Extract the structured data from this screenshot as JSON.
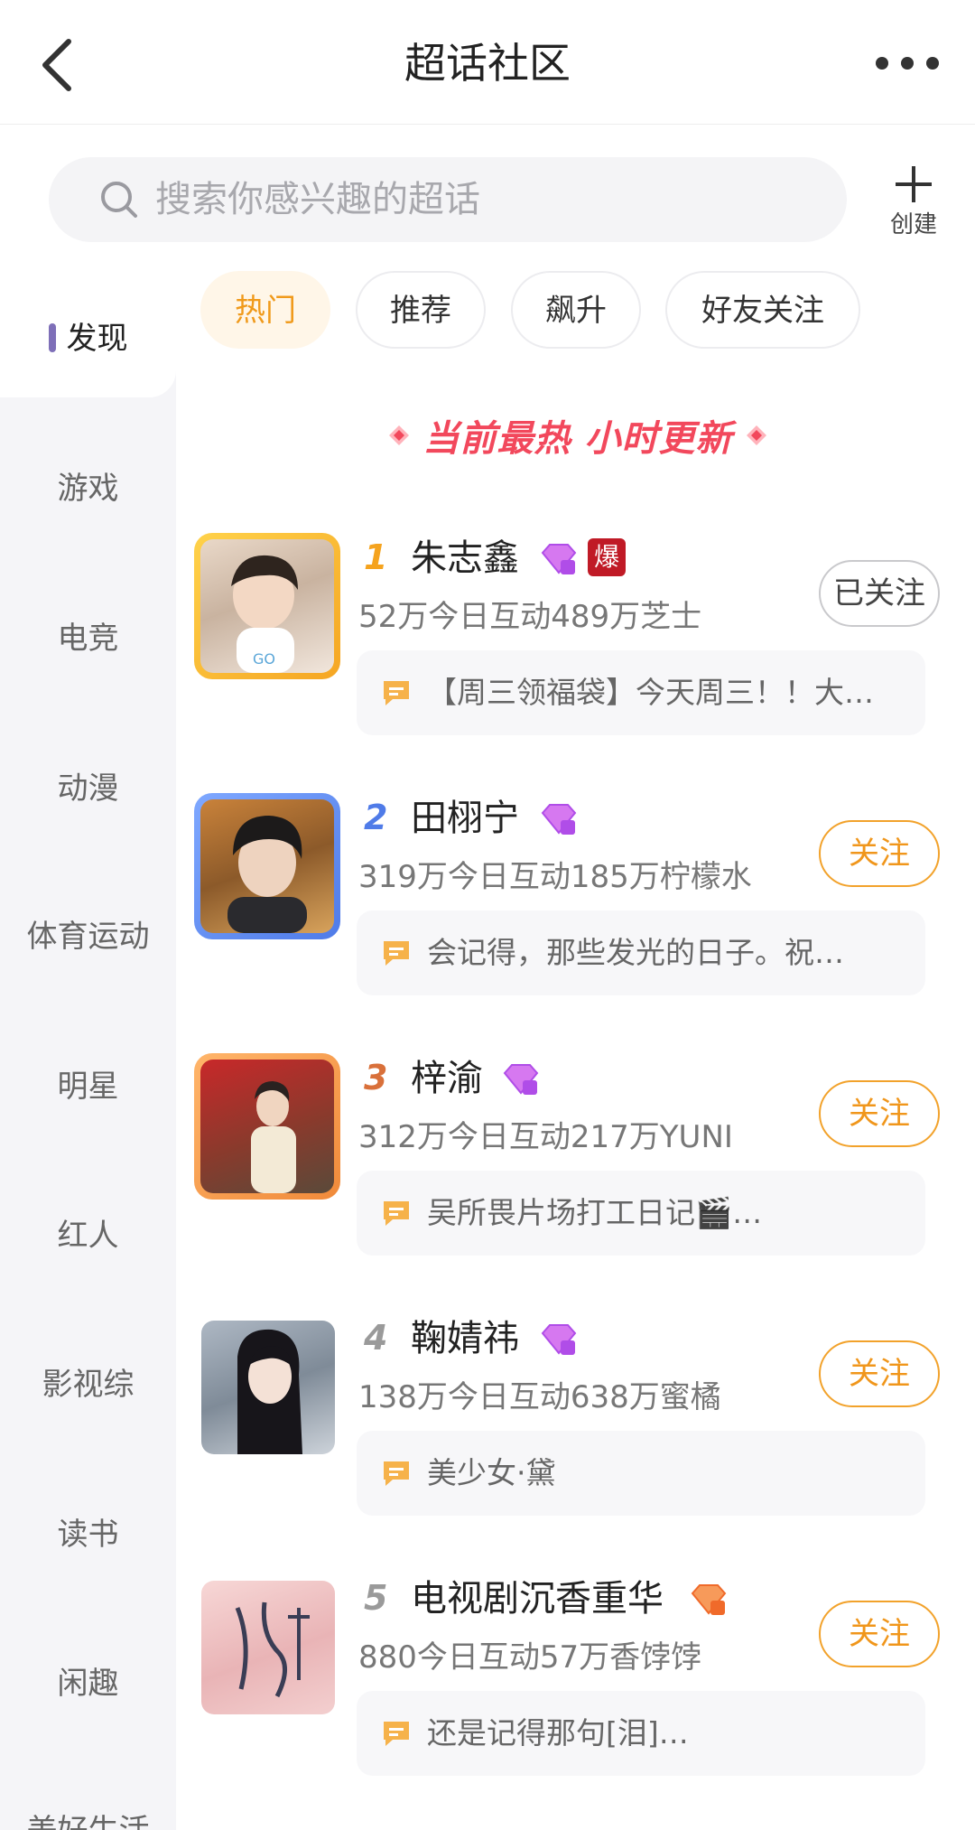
{
  "header": {
    "title": "超话社区"
  },
  "search": {
    "placeholder": "搜索你感兴趣的超话"
  },
  "create": {
    "label": "创建"
  },
  "sidebar": {
    "items": [
      {
        "label": "发现",
        "active": true
      },
      {
        "label": "游戏"
      },
      {
        "label": "电竞"
      },
      {
        "label": "动漫"
      },
      {
        "label": "体育运动"
      },
      {
        "label": "明星"
      },
      {
        "label": "红人"
      },
      {
        "label": "影视综"
      },
      {
        "label": "读书"
      },
      {
        "label": "闲趣"
      },
      {
        "label": "美好生活"
      }
    ]
  },
  "tabs": [
    {
      "label": "热门",
      "active": true
    },
    {
      "label": "推荐"
    },
    {
      "label": "飙升"
    },
    {
      "label": "好友关注"
    }
  ],
  "banner": {
    "text": "当前最热 小时更新"
  },
  "topics": [
    {
      "rank": "1",
      "name": "朱志鑫",
      "hot_badge": "爆",
      "stats": "52万今日互动489万芝士",
      "post": "【周三领福袋】今天周三！！大…",
      "follow_label": "已关注",
      "followed": true
    },
    {
      "rank": "2",
      "name": "田栩宁",
      "stats": "319万今日互动185万柠檬水",
      "post": "会记得，那些发光的日子。祝…",
      "follow_label": "关注",
      "followed": false
    },
    {
      "rank": "3",
      "name": "梓渝",
      "stats": "312万今日互动217万YUNI",
      "post": "吴所畏片场打工日记🎬…",
      "follow_label": "关注",
      "followed": false
    },
    {
      "rank": "4",
      "name": "鞠婧祎",
      "stats": "138万今日互动638万蜜橘",
      "post": "美少女·黛",
      "follow_label": "关注",
      "followed": false
    },
    {
      "rank": "5",
      "name": "电视剧沉香重华",
      "stats": "880今日互动57万香饽饽",
      "post": "还是记得那句[泪]…",
      "follow_label": "关注",
      "followed": false
    }
  ],
  "colors": {
    "accent": "#f0961b",
    "banner": "#f2485c",
    "active_bar": "#7e6fb8",
    "gem_purple": "#b04de8",
    "gem_orange": "#f06a2a"
  }
}
